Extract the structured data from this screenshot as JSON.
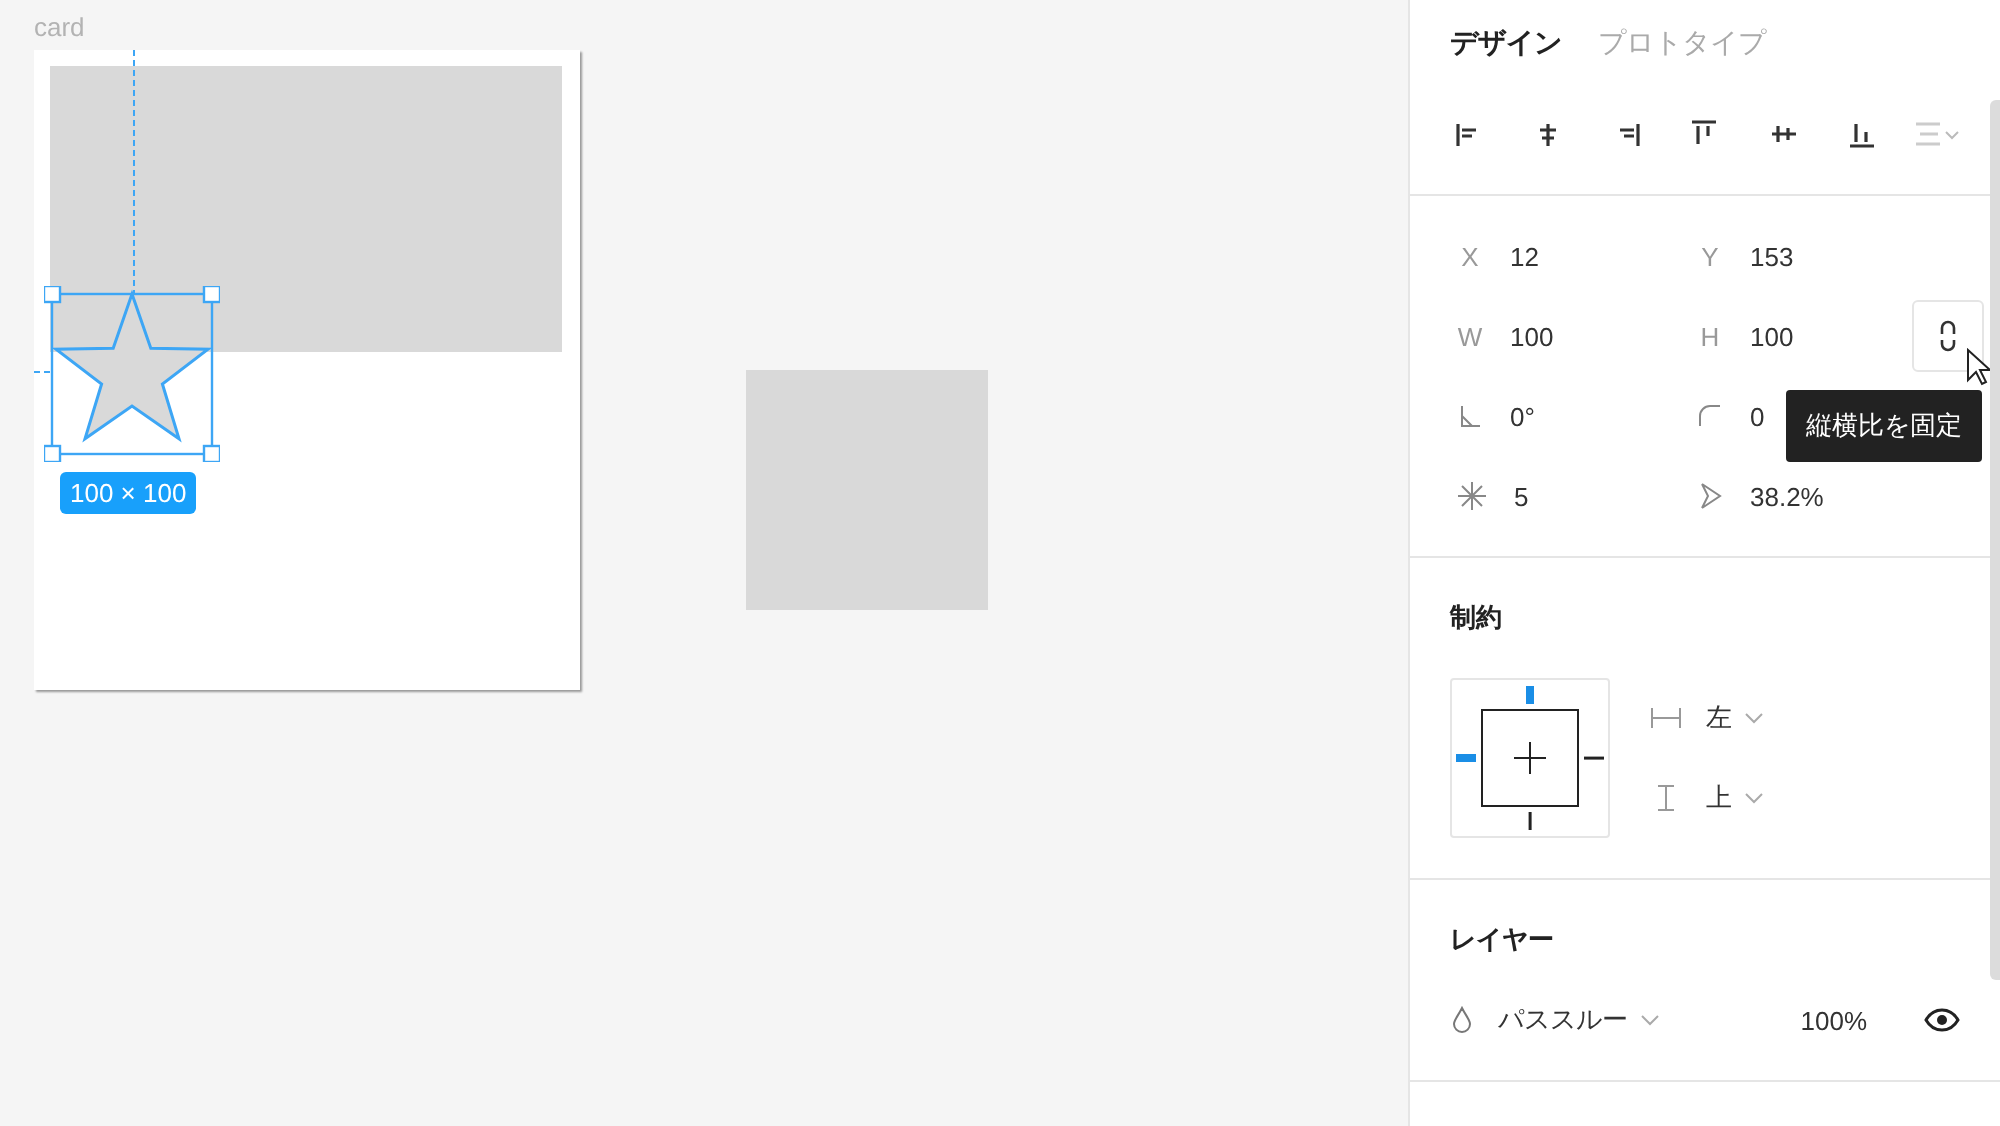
{
  "canvas": {
    "frame_label": "card",
    "selection_size": "100 × 100"
  },
  "panel": {
    "tabs": [
      {
        "label": "デザイン",
        "selected": true
      },
      {
        "label": "プロトタイプ",
        "selected": false
      }
    ],
    "properties": [
      {
        "kind": "text",
        "label": "X",
        "value": "12"
      },
      {
        "kind": "text",
        "label": "Y",
        "value": "153"
      },
      {
        "kind": "text",
        "label": "W",
        "value": "100"
      },
      {
        "kind": "text",
        "label": "H",
        "value": "100"
      },
      {
        "kind": "rotation",
        "value": "0°"
      },
      {
        "kind": "radius",
        "value": "0"
      },
      {
        "kind": "points",
        "value": "5"
      },
      {
        "kind": "ratio",
        "value": "38.2%"
      }
    ],
    "lock_tooltip": "縦横比を固定",
    "constraints": {
      "title": "制約",
      "pins": {
        "top": true,
        "left": true,
        "right": false,
        "bottom": false
      },
      "horizontal": "左",
      "vertical": "上"
    },
    "layer": {
      "title": "レイヤー",
      "blend": "パススルー",
      "opacity": "100%",
      "visible": true
    }
  }
}
